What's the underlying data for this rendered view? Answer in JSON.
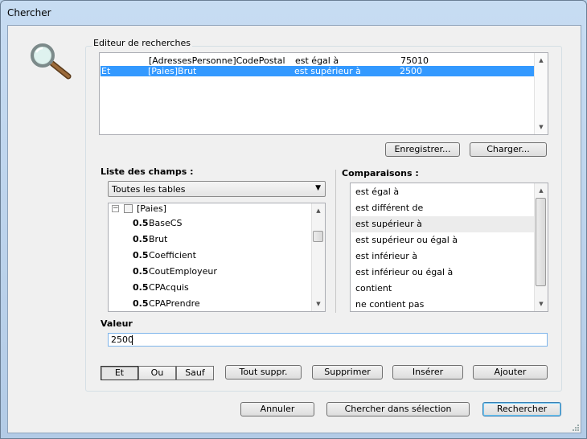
{
  "window": {
    "title": "Chercher"
  },
  "editor": {
    "legend": "Editeur de recherches",
    "rows": [
      {
        "connector": "",
        "field": "[AdressesPersonne]CodePostal",
        "operator": "est égal à",
        "value": "75010",
        "selected": false
      },
      {
        "connector": "Et",
        "field": "[Paies]Brut",
        "operator": "est supérieur à",
        "value": "2500",
        "selected": true
      }
    ],
    "save_label": "Enregistrer...",
    "load_label": "Charger..."
  },
  "fields": {
    "label": "Liste des champs :",
    "table_select": "Toutes les tables",
    "table_name": "[Paies]",
    "items": [
      {
        "type": "0.5",
        "name": "BaseCS"
      },
      {
        "type": "0.5",
        "name": "Brut"
      },
      {
        "type": "0.5",
        "name": "Coefficient"
      },
      {
        "type": "0.5",
        "name": "CoutEmployeur"
      },
      {
        "type": "0.5",
        "name": "CPAcquis"
      },
      {
        "type": "0.5",
        "name": "CPAPrendre"
      }
    ]
  },
  "comparisons": {
    "label": "Comparaisons :",
    "items": [
      "est égal à",
      "est différent de",
      "est supérieur à",
      "est supérieur ou égal à",
      "est inférieur à",
      "est inférieur ou égal à",
      "contient",
      "ne contient pas"
    ],
    "highlighted": 2
  },
  "value": {
    "label": "Valeur",
    "input": "2500"
  },
  "logic": {
    "and": "Et",
    "or": "Ou",
    "except": "Sauf"
  },
  "actions": {
    "clear_all": "Tout suppr.",
    "delete": "Supprimer",
    "insert": "Insérer",
    "add": "Ajouter"
  },
  "footer": {
    "cancel": "Annuler",
    "search_selection": "Chercher dans sélection",
    "search": "Rechercher"
  },
  "colors": {
    "selection": "#3399ff",
    "client_bg": "#f0f0f0",
    "frame": "#bcd4ec"
  }
}
